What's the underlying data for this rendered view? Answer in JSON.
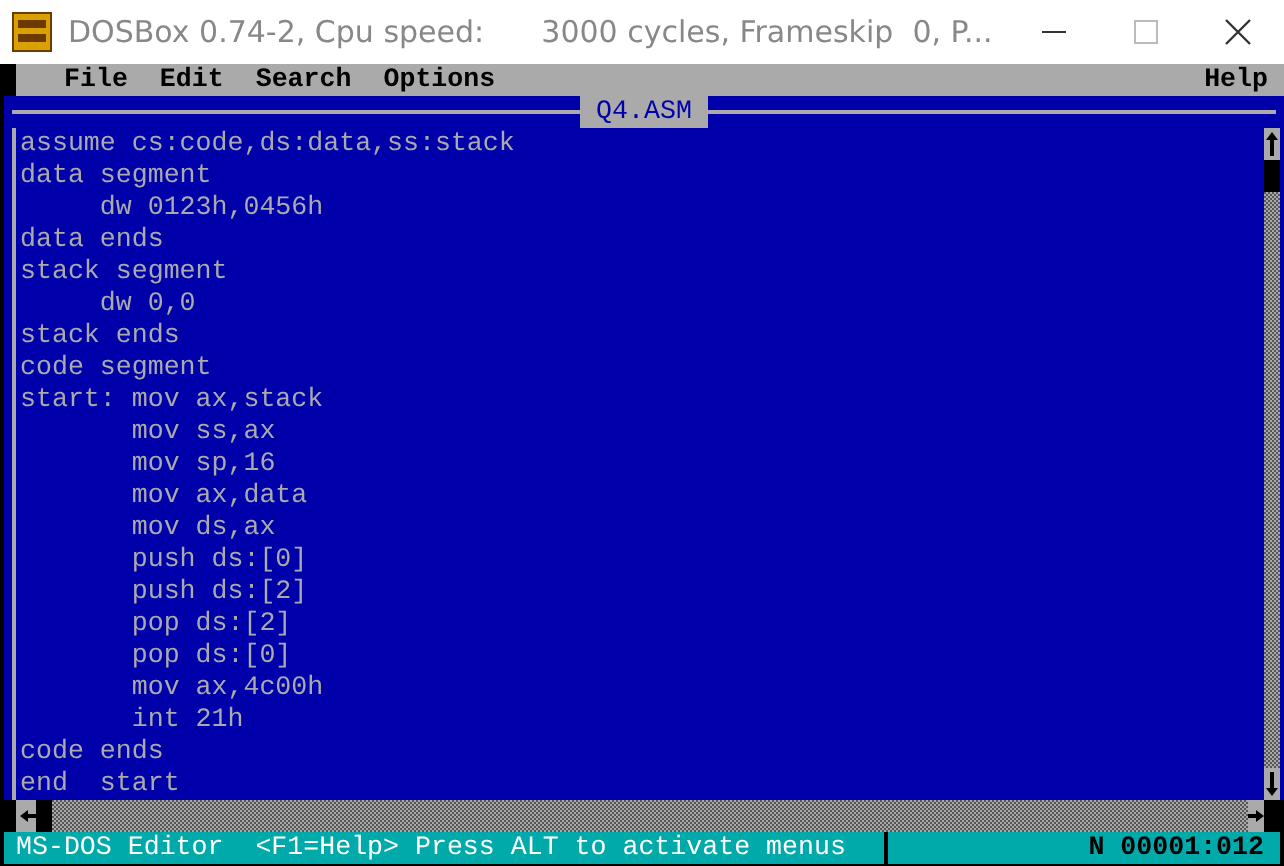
{
  "window": {
    "title": "DOSBox 0.74-2, Cpu speed:      3000 cycles, Frameskip  0, P..."
  },
  "menu": [
    {
      "label": "File",
      "selected": false
    },
    {
      "label": "Edit",
      "selected": false
    },
    {
      "label": "Search",
      "selected": false
    },
    {
      "label": "Options",
      "selected": false
    }
  ],
  "help_menu": {
    "label": "Help",
    "selected": false
  },
  "editor": {
    "title": "Q4.ASM",
    "lines": [
      "assume cs:code,ds:data,ss:stack",
      "data segment",
      "     dw 0123h,0456h",
      "data ends",
      "stack segment",
      "     dw 0,0",
      "stack ends",
      "code segment",
      "start: mov ax,stack",
      "       mov ss,ax",
      "       mov sp,16",
      "       mov ax,data",
      "       mov ds,ax",
      "       push ds:[0]",
      "       push ds:[2]",
      "       pop ds:[2]",
      "       pop ds:[0]",
      "       mov ax,4c00h",
      "       int 21h",
      "code ends",
      "end  start"
    ]
  },
  "status_bar": {
    "message": "MS-DOS Editor  <F1=Help> Press ALT to activate menus",
    "position": "N 00001:012"
  }
}
